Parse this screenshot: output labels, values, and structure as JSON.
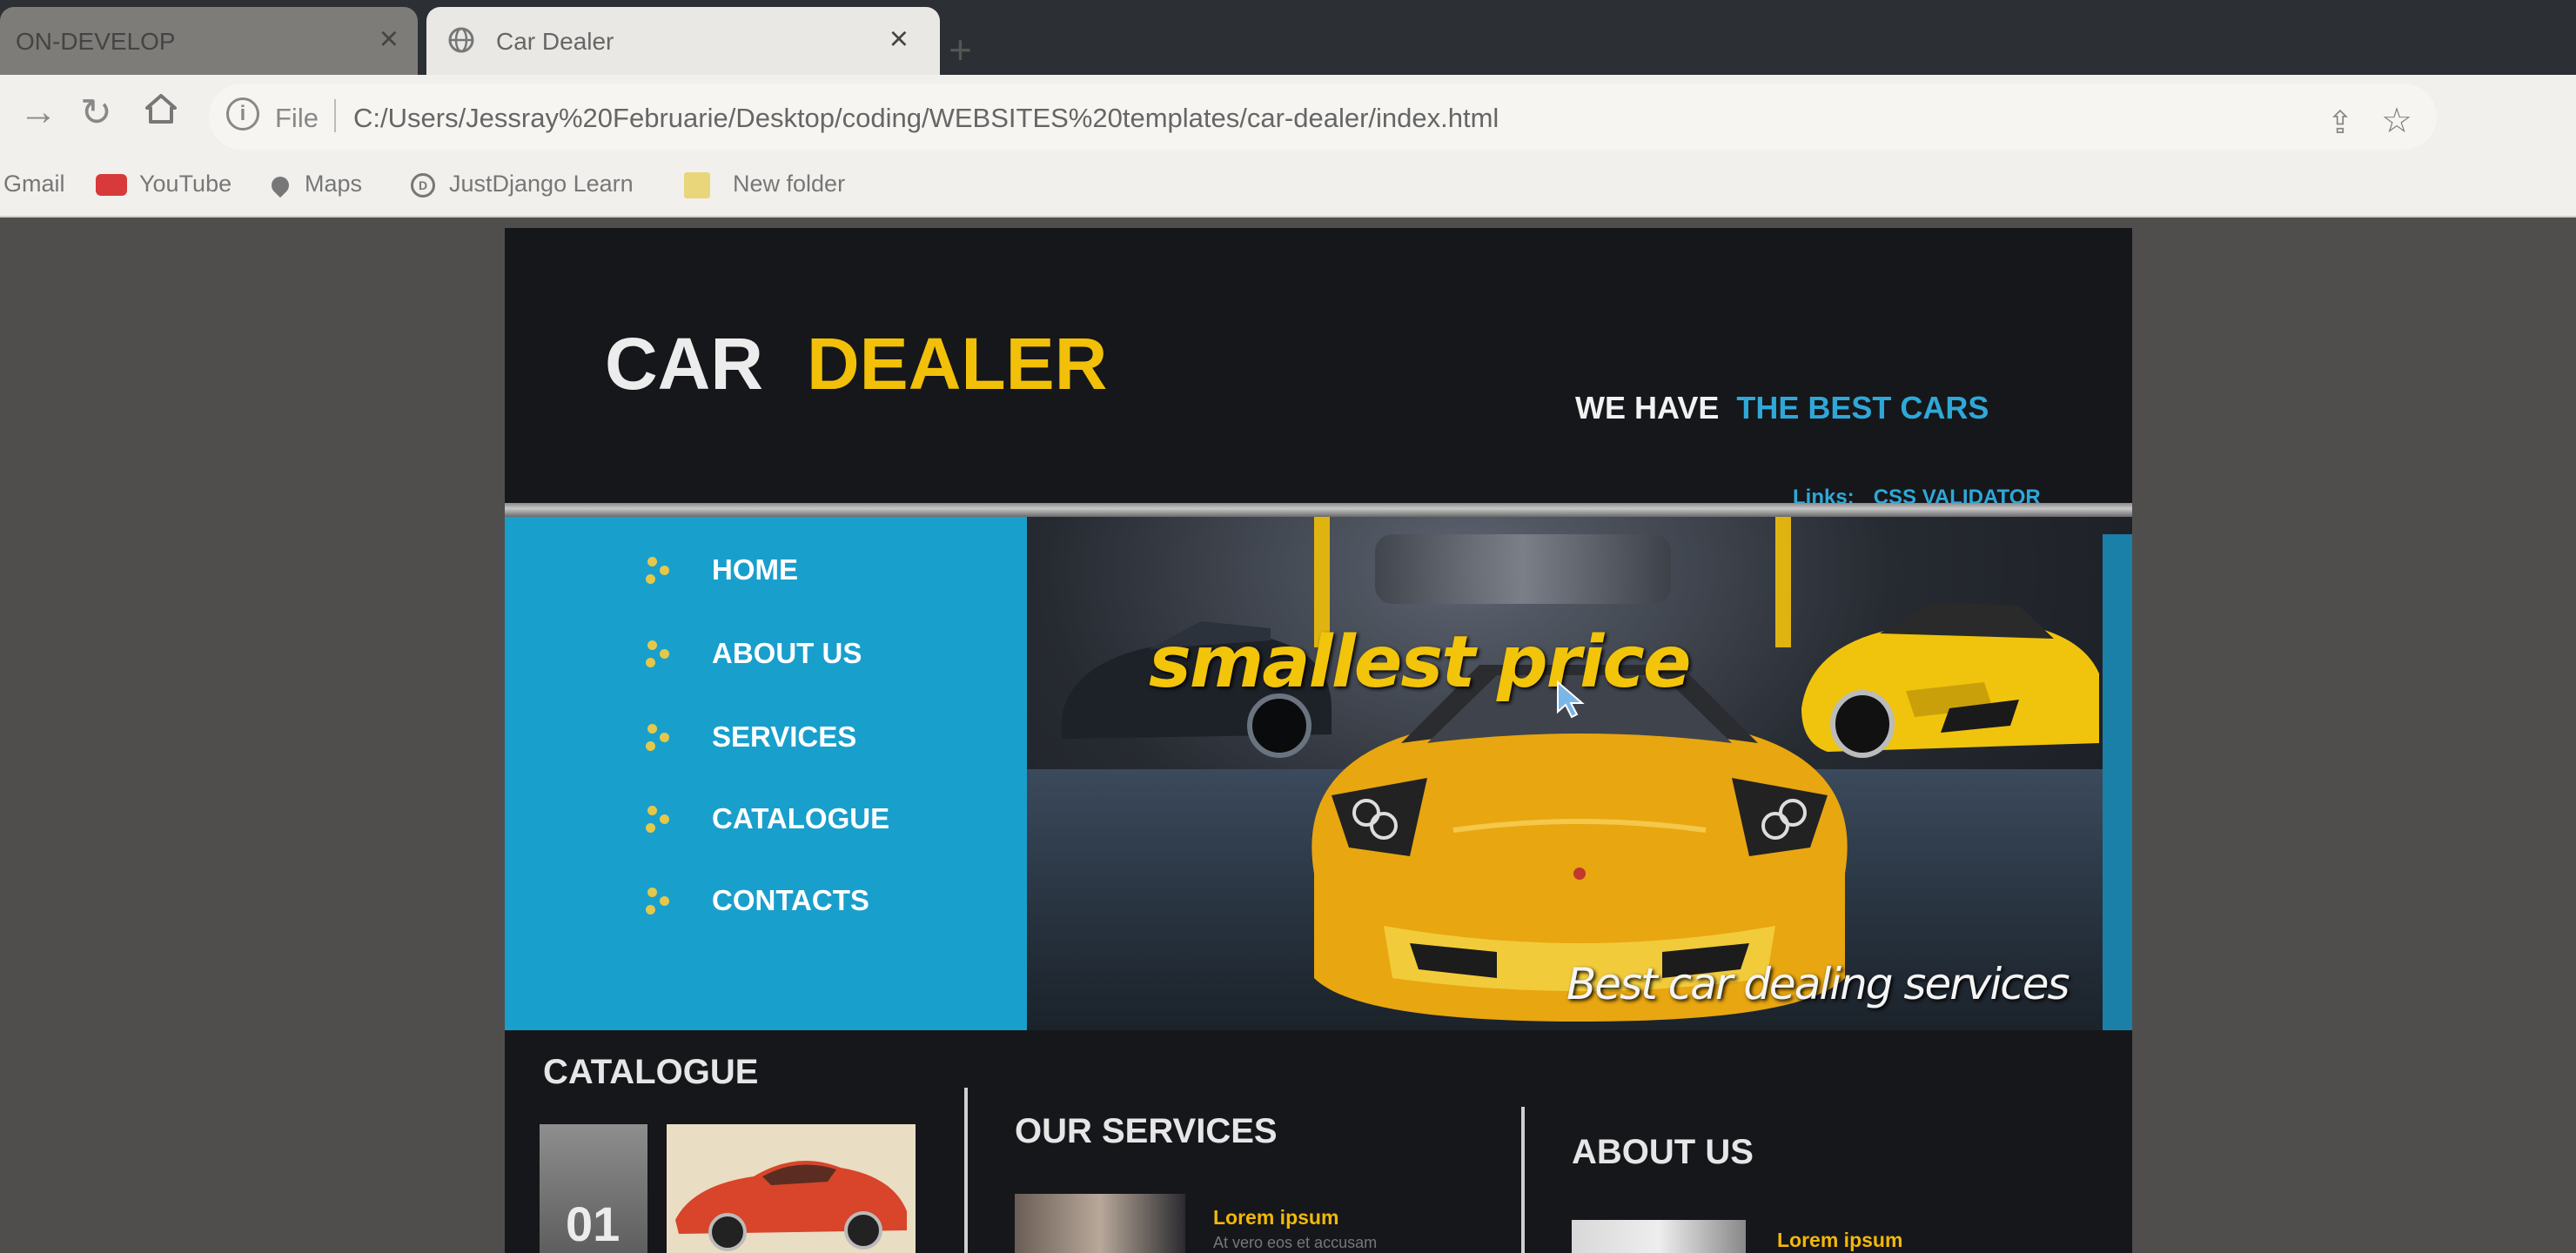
{
  "browser": {
    "tabs": [
      {
        "title": "ON-DEVELOP",
        "active": false
      },
      {
        "title": "Car Dealer",
        "active": true
      }
    ],
    "address": {
      "scheme_label": "File",
      "url": "C:/Users/Jessray%20Februarie/Desktop/coding/WEBSITES%20templates/car-dealer/index.html"
    },
    "bookmarks": [
      "Gmail",
      "YouTube",
      "Maps",
      "JustDjango Learn",
      "New folder"
    ],
    "icons": {
      "back": "back-arrow-icon",
      "reload": "reload-icon",
      "home": "home-icon",
      "info": "info-icon",
      "share": "share-icon",
      "bookmark": "star-icon"
    }
  },
  "site": {
    "logo": {
      "word1": "CAR",
      "word2": "DEALER"
    },
    "slogan": {
      "part1": "WE HAVE",
      "part2": "THE BEST CARS"
    },
    "links": {
      "label": "Links:",
      "items": [
        "CSS VALIDATOR"
      ]
    },
    "nav": [
      "HOME",
      "ABOUT US",
      "SERVICES",
      "CATALOGUE",
      "CONTACTS"
    ],
    "hero": {
      "title": "smallest price",
      "subtitle": "Best car dealing services"
    },
    "sections": {
      "catalogue": {
        "title": "CATALOGUE",
        "item_number": "01"
      },
      "services": {
        "title": "OUR SERVICES",
        "item_title": "Lorem ipsum",
        "item_text": "At vero eos et accusam"
      },
      "about": {
        "title": "ABOUT US",
        "item_title": "Lorem ipsum"
      }
    },
    "colors": {
      "accent_yellow": "#f2c008",
      "accent_blue": "#2fa8d8",
      "nav_bg": "#199fcc",
      "page_bg": "#15171b"
    }
  }
}
